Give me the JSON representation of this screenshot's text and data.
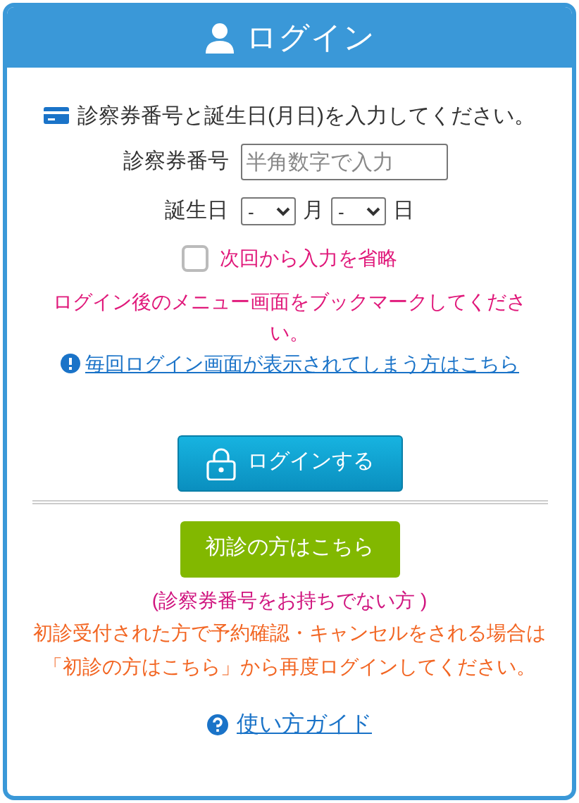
{
  "header": {
    "title": "ログイン"
  },
  "instruction": "診察券番号と誕生日(月日)を入力してください。",
  "card_number": {
    "label": "診察券番号",
    "placeholder": "半角数字で入力"
  },
  "birthday": {
    "label": "誕生日",
    "month_value": "-",
    "month_unit": "月",
    "day_value": "-",
    "day_unit": "日"
  },
  "remember": {
    "label": "次回から入力を省略",
    "checked": false
  },
  "bookmark_note": "ログイン後のメニュー画面をブックマークしてください。",
  "help_link": "毎回ログイン画面が表示されてしまう方はこちら",
  "login_button": "ログインする",
  "first_visit_button": "初診の方はこちら",
  "first_visit_note": "(診察券番号をお持ちでない方 )",
  "first_visit_info": "初診受付された方で予約確認・キャンセルをされる場合は「初診の方はこちら」から再度ログインしてください。",
  "guide_link": "使い方ガイド"
}
